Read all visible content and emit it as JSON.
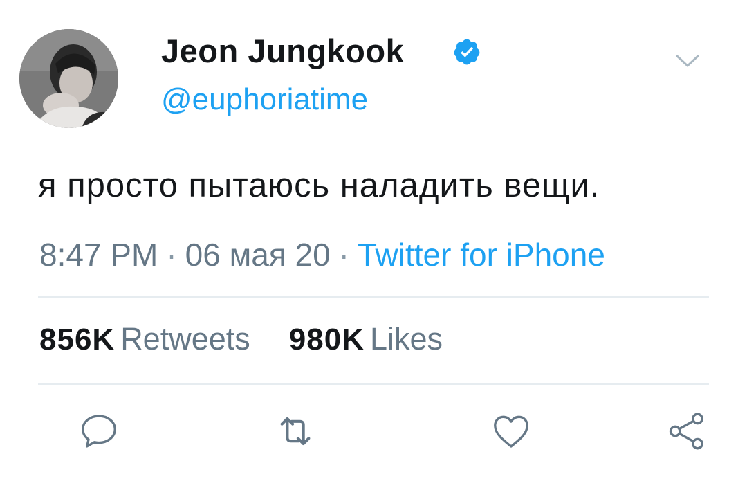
{
  "author": {
    "display_name": "Jeon Jungkook",
    "handle": "@euphoriatime",
    "verified": true,
    "avatar_icon": "profile-photo"
  },
  "tweet": {
    "text": "я просто пытаюсь наладить вещи.",
    "time": "8:47 PM",
    "date": "06 мая 20",
    "source": "Twitter for iPhone",
    "separator": "·"
  },
  "stats": {
    "retweets_count": "856K",
    "retweets_label": "Retweets",
    "likes_count": "980K",
    "likes_label": "Likes"
  },
  "actions": [
    {
      "name": "reply",
      "icon": "speech-bubble-icon"
    },
    {
      "name": "retweet",
      "icon": "retweet-arrows-icon"
    },
    {
      "name": "like",
      "icon": "heart-icon"
    },
    {
      "name": "share",
      "icon": "share-nodes-icon"
    }
  ],
  "colors": {
    "text": "#14171a",
    "secondary": "#657786",
    "accent": "#1da1f2",
    "divider": "#e6ecf0",
    "icon": "#657786"
  }
}
